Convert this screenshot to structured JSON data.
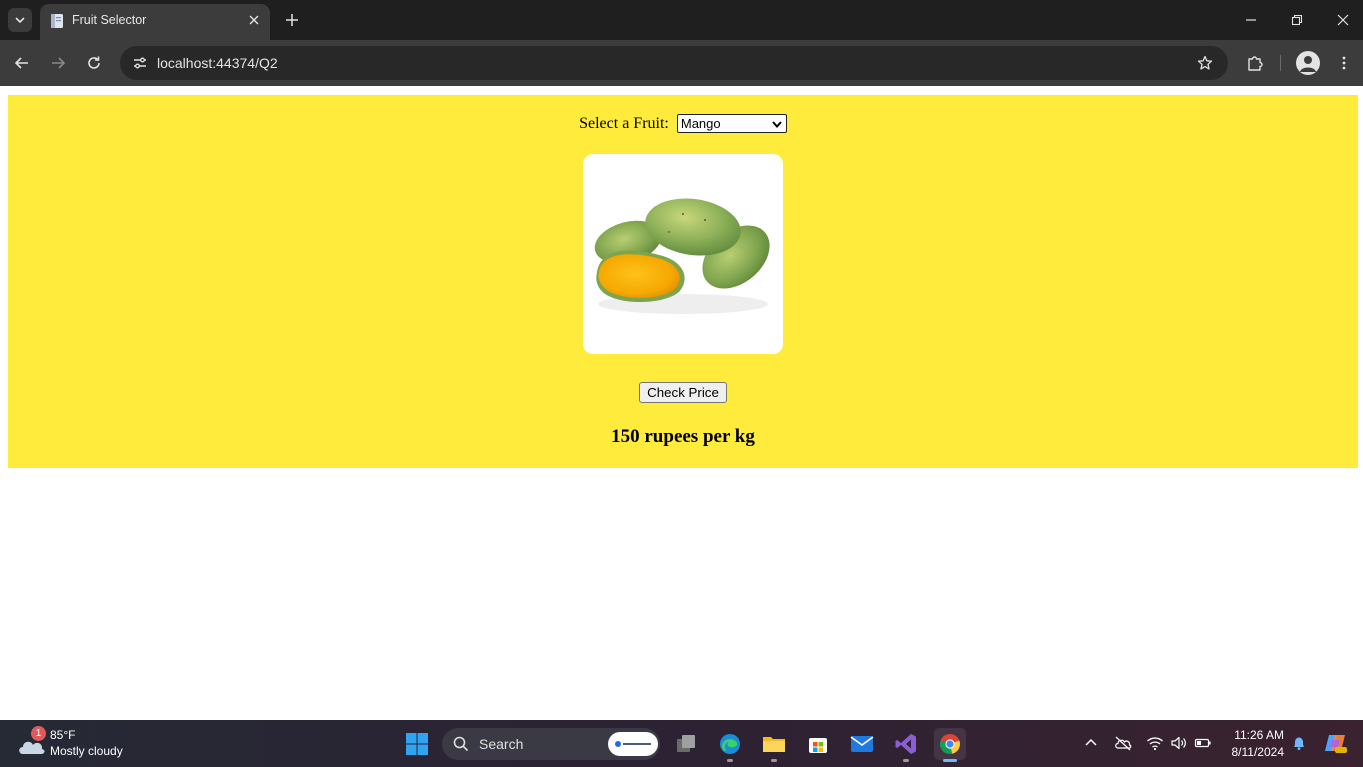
{
  "browser": {
    "tab_title": "Fruit Selector",
    "url": "localhost:44374/Q2"
  },
  "page": {
    "select_label": "Select a Fruit:",
    "selected_fruit": "Mango",
    "check_button_label": "Check Price",
    "price_text": "150 rupees per kg",
    "panel_color": "#ffeb3b"
  },
  "taskbar": {
    "weather_badge": "1",
    "weather_temp": "85°F",
    "weather_desc": "Mostly cloudy",
    "search_label": "Search",
    "time": "11:26 AM",
    "date": "8/11/2024",
    "apps": [
      "task-view",
      "edge",
      "file-explorer",
      "microsoft-store",
      "mail",
      "visual-studio",
      "chrome"
    ]
  }
}
